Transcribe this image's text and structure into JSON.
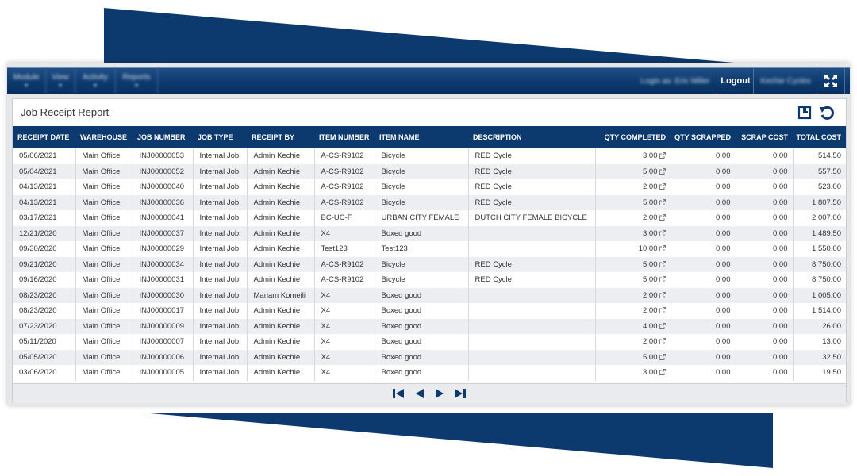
{
  "colors": {
    "navy": "#0d3a6e",
    "header_bg": "#0d3a6e",
    "row_alt": "#eceef1"
  },
  "topbar": {
    "menus": [
      {
        "label": "Module"
      },
      {
        "label": "View"
      },
      {
        "label": "Activity"
      },
      {
        "label": "Reports"
      }
    ],
    "login_text": "Login as: Eric Miller",
    "logout_label": "Logout",
    "company_text": "Kechie Cycles",
    "fullscreen_icon": "expand-icon"
  },
  "panel": {
    "title": "Job Receipt Report",
    "export_icon": "export-icon",
    "refresh_icon": "refresh-icon"
  },
  "table": {
    "columns": [
      "RECEIPT DATE",
      "WAREHOUSE",
      "JOB NUMBER",
      "JOB TYPE",
      "RECEIPT BY",
      "ITEM NUMBER",
      "ITEM NAME",
      "DESCRIPTION",
      "QTY COMPLETED",
      "QTY SCRAPPED",
      "SCRAP COST",
      "TOTAL COST"
    ],
    "rows": [
      [
        "05/06/2021",
        "Main Office",
        "INJ00000053",
        "Internal Job",
        "Admin Kechie",
        "A-CS-R9102",
        "Bicycle",
        "RED Cycle",
        "3.00",
        "0.00",
        "0.00",
        "514.50"
      ],
      [
        "05/04/2021",
        "Main Office",
        "INJ00000052",
        "Internal Job",
        "Admin Kechie",
        "A-CS-R9102",
        "Bicycle",
        "RED Cycle",
        "5.00",
        "0.00",
        "0.00",
        "557.50"
      ],
      [
        "04/13/2021",
        "Main Office",
        "INJ00000040",
        "Internal Job",
        "Admin Kechie",
        "A-CS-R9102",
        "Bicycle",
        "RED Cycle",
        "2.00",
        "0.00",
        "0.00",
        "523.00"
      ],
      [
        "04/13/2021",
        "Main Office",
        "INJ00000036",
        "Internal Job",
        "Admin Kechie",
        "A-CS-R9102",
        "Bicycle",
        "RED Cycle",
        "5.00",
        "0.00",
        "0.00",
        "1,807.50"
      ],
      [
        "03/17/2021",
        "Main Office",
        "INJ00000041",
        "Internal Job",
        "Admin Kechie",
        "BC-UC-F",
        "URBAN CITY FEMALE",
        "DUTCH CITY FEMALE BICYCLE",
        "2.00",
        "0.00",
        "0.00",
        "2,007.00"
      ],
      [
        "12/21/2020",
        "Main Office",
        "INJ00000037",
        "Internal Job",
        "Admin Kechie",
        "X4",
        "Boxed good",
        "",
        "3.00",
        "0.00",
        "0.00",
        "1,489.50"
      ],
      [
        "09/30/2020",
        "Main Office",
        "INJ00000029",
        "Internal Job",
        "Admin Kechie",
        "Test123",
        "Test123",
        "",
        "10.00",
        "0.00",
        "0.00",
        "1,550.00"
      ],
      [
        "09/21/2020",
        "Main Office",
        "INJ00000034",
        "Internal Job",
        "Admin Kechie",
        "A-CS-R9102",
        "Bicycle",
        "RED Cycle",
        "5.00",
        "0.00",
        "0.00",
        "8,750.00"
      ],
      [
        "09/16/2020",
        "Main Office",
        "INJ00000031",
        "Internal Job",
        "Admin Kechie",
        "A-CS-R9102",
        "Bicycle",
        "RED Cycle",
        "5.00",
        "0.00",
        "0.00",
        "8,750.00"
      ],
      [
        "08/23/2020",
        "Main Office",
        "INJ00000030",
        "Internal Job",
        "Mariam Komeili",
        "X4",
        "Boxed good",
        "",
        "2.00",
        "0.00",
        "0.00",
        "1,005.00"
      ],
      [
        "08/23/2020",
        "Main Office",
        "INJ00000017",
        "Internal Job",
        "Admin Kechie",
        "X4",
        "Boxed good",
        "",
        "2.00",
        "0.00",
        "0.00",
        "1,514.00"
      ],
      [
        "07/23/2020",
        "Main Office",
        "INJ00000009",
        "Internal Job",
        "Admin Kechie",
        "X4",
        "Boxed good",
        "",
        "4.00",
        "0.00",
        "0.00",
        "26.00"
      ],
      [
        "05/11/2020",
        "Main Office",
        "INJ00000007",
        "Internal Job",
        "Admin Kechie",
        "X4",
        "Boxed good",
        "",
        "2.00",
        "0.00",
        "0.00",
        "13.00"
      ],
      [
        "05/05/2020",
        "Main Office",
        "INJ00000006",
        "Internal Job",
        "Admin Kechie",
        "X4",
        "Boxed good",
        "",
        "5.00",
        "0.00",
        "0.00",
        "32.50"
      ],
      [
        "03/06/2020",
        "Main Office",
        "INJ00000005",
        "Internal Job",
        "Admin Kechie",
        "X4",
        "Boxed good",
        "",
        "3.00",
        "0.00",
        "0.00",
        "19.50"
      ]
    ]
  },
  "pager": {
    "icons": [
      "first-page-icon",
      "previous-page-icon",
      "next-page-icon",
      "last-page-icon"
    ]
  }
}
